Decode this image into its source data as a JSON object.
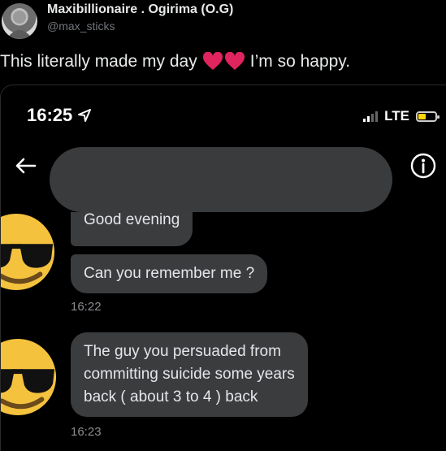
{
  "tweet": {
    "author_name": "Maxibillionaire . Ogirima (O.G)",
    "author_handle": "@max_sticks",
    "text_before": "This literally made my day",
    "text_after": "I’m so happy.",
    "heart_color": "#e0245e"
  },
  "phone": {
    "status_time": "16:25",
    "network": "LTE",
    "battery_color": "#ffd60a"
  },
  "chat": {
    "messages": [
      {
        "text": "Good evening"
      },
      {
        "text": "Can you remember me ?"
      },
      {
        "text_lines": [
          "The guy you persuaded from",
          "committing suicide some years",
          "back ( about 3 to 4 ) back"
        ]
      }
    ],
    "timestamps": [
      "16:22",
      "16:23"
    ],
    "bubble_color": "#3b3c3e",
    "contact_pill_color": "#3a3b3d"
  },
  "icons": [
    "location-arrow-icon",
    "signal-icon",
    "battery-icon",
    "back-arrow-icon",
    "info-icon",
    "sunglasses-emoji-icon",
    "heart-icon"
  ]
}
